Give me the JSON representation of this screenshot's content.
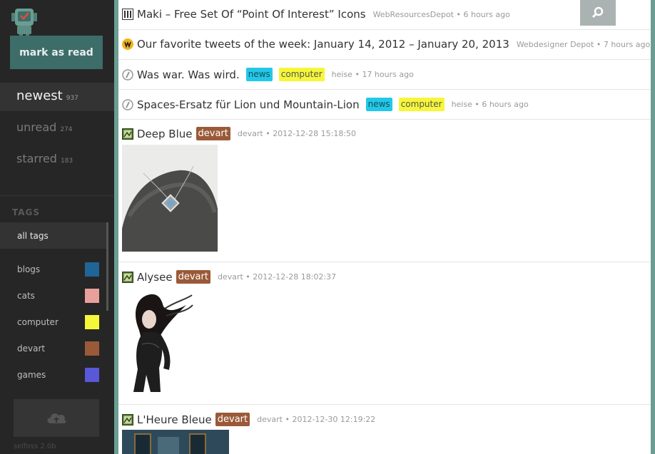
{
  "sidebar": {
    "logo_icon": "robot-logo-icon",
    "mark_as_read": "mark as read",
    "filters": [
      {
        "label": "newest",
        "count": "937"
      },
      {
        "label": "unread",
        "count": "274"
      },
      {
        "label": "starred",
        "count": "183"
      }
    ],
    "tags_heading": "TAGS",
    "all_tags": "all tags",
    "tags": [
      {
        "label": "blogs",
        "color": "#1f6596"
      },
      {
        "label": "cats",
        "color": "#e7a09a"
      },
      {
        "label": "computer",
        "color": "#f6f63a"
      },
      {
        "label": "devart",
        "color": "#9a5a38"
      },
      {
        "label": "games",
        "color": "#5858d8"
      }
    ],
    "upload_icon": "cloud-upload-icon",
    "version": "selfoss 2.0b"
  },
  "search_icon": "search-icon",
  "entries": [
    {
      "title": "Maki – Free Set Of “Point Of Interest” Icons",
      "source": "WebResourcesDepot",
      "time": "6 hours ago",
      "icon": "webresourcesdepot-favicon"
    },
    {
      "title": "Our favorite tweets of the week: January 14, 2012 – January 20, 2013",
      "source": "Webdesigner Depot",
      "time": "7 hours ago",
      "icon": "webdesigner-depot-favicon"
    },
    {
      "title": "Was war. Was wird.",
      "tags": [
        "news",
        "computer"
      ],
      "source": "heise",
      "time": "17 hours ago",
      "icon": "heise-favicon"
    },
    {
      "title": "Spaces-Ersatz für Lion und Mountain-Lion",
      "tags": [
        "news",
        "computer"
      ],
      "source": "heise",
      "time": "6 hours ago",
      "icon": "heise-favicon"
    },
    {
      "title": "Deep Blue",
      "tags": [
        "devart"
      ],
      "source": "devart",
      "time": "2012-12-28 15:18:50",
      "icon": "deviantart-favicon",
      "image": "pendant-on-rock-photo"
    },
    {
      "title": "Alysee",
      "tags": [
        "devart"
      ],
      "source": "devart",
      "time": "2012-12-28 18:02:37",
      "icon": "deviantart-favicon",
      "image": "dark-haired-figure-illustration"
    },
    {
      "title": "L'Heure Bleue",
      "tags": [
        "devart"
      ],
      "source": "devart",
      "time": "2012-12-30 12:19:22",
      "icon": "deviantart-favicon",
      "image": "blue-room-photo"
    }
  ]
}
